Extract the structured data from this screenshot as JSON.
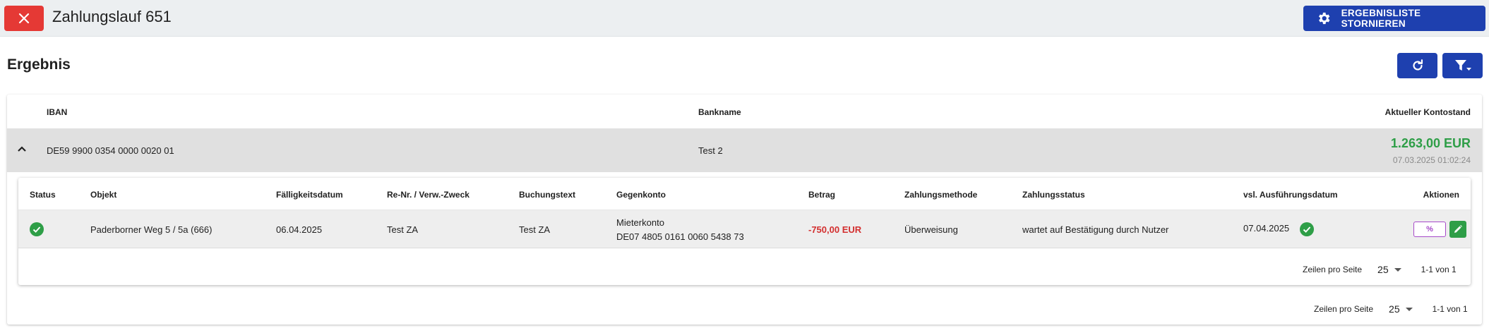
{
  "header": {
    "title": "Zahlungslauf 651",
    "storno_label": "ERGEBNISLISTE STORNIEREN"
  },
  "section": {
    "title": "Ergebnis"
  },
  "colors": {
    "primary": "#1e40af",
    "danger": "#e53935",
    "success": "#2e9e47",
    "negative": "#d32f2f"
  },
  "accounts_table": {
    "columns": [
      "IBAN",
      "Bankname",
      "Aktueller Kontostand"
    ],
    "row": {
      "iban": "DE59 9900 0354 0000 0020 01",
      "bankname": "Test 2",
      "balance": "1.263,00 EUR",
      "timestamp": "07.03.2025 01:02:24"
    },
    "pager": {
      "label": "Zeilen pro Seite",
      "size": "25",
      "range": "1-1 von 1"
    }
  },
  "payments_table": {
    "columns": {
      "status": "Status",
      "objekt": "Objekt",
      "faellig": "Fälligkeitsdatum",
      "reNr": "Re-Nr. / Verw.-Zweck",
      "buchungstext": "Buchungstext",
      "gegenkonto": "Gegenkonto",
      "betrag": "Betrag",
      "methode": "Zahlungsmethode",
      "zstatus": "Zahlungsstatus",
      "ausfuehrung": "vsl. Ausführungsdatum",
      "aktionen": "Aktionen"
    },
    "row": {
      "objekt": "Paderborner Weg 5 / 5a (666)",
      "faellig": "06.04.2025",
      "reNr": "Test ZA",
      "buchungstext": "Test ZA",
      "gegenkonto_name": "Mieterkonto",
      "gegenkonto_iban": "DE07 4805 0161 0060 5438 73",
      "betrag": "-750,00 EUR",
      "methode": "Überweisung",
      "zstatus": "wartet auf Bestätigung durch Nutzer",
      "ausfuehrung": "07.04.2025",
      "percent_label": "%"
    },
    "pager": {
      "label": "Zeilen pro Seite",
      "size": "25",
      "range": "1-1 von 1"
    }
  }
}
